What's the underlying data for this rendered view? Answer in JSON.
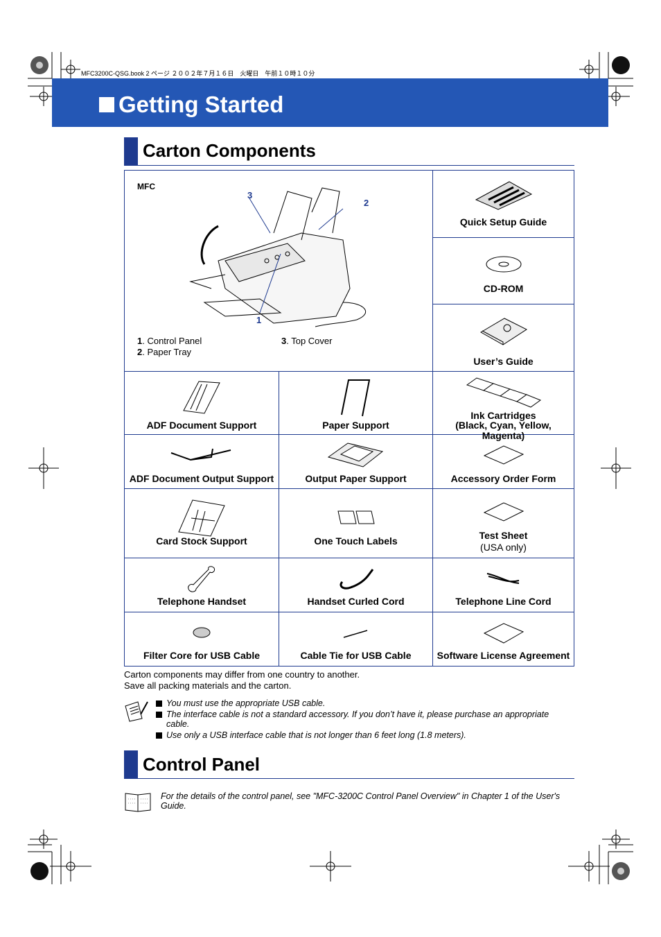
{
  "header": {
    "book_line": "MFC3200C-QSG.book 2 ページ ２００２年７月１６日　火曜日　午前１０時１０分",
    "banner_title": "Getting Started",
    "banner_color": "#2457b5",
    "accent_color": "#1e3a8f"
  },
  "carton": {
    "title": "Carton Components",
    "mfc": {
      "label": "MFC",
      "callouts": [
        "1",
        "2",
        "3"
      ],
      "legend": [
        {
          "num": "1",
          "text": ". Control Panel"
        },
        {
          "num": "2",
          "text": ". Paper Tray"
        },
        {
          "num": "3",
          "text": ". Top Cover"
        }
      ]
    },
    "items": [
      {
        "label": "Quick Setup Guide",
        "icon": "booklet-icon"
      },
      {
        "label": "CD-ROM",
        "icon": "cd-icon"
      },
      {
        "label": "User’s Guide",
        "icon": "book-icon"
      },
      {
        "label": "ADF Document Support",
        "icon": "adf-support-icon"
      },
      {
        "label": "Paper Support",
        "icon": "paper-support-icon"
      },
      {
        "label": "Ink Cartridges",
        "sub": "(Black, Cyan, Yellow, Magenta)",
        "icon": "ink-cartridge-icon"
      },
      {
        "label": "ADF Document Output Support",
        "icon": "wire-icon"
      },
      {
        "label": "Output Paper Support",
        "icon": "tray-icon"
      },
      {
        "label": "Accessory Order Form",
        "icon": "sheet-icon"
      },
      {
        "label": "Card Stock Support",
        "icon": "card-stock-icon"
      },
      {
        "label": "One Touch Labels",
        "icon": "labels-icon"
      },
      {
        "label": "Test Sheet",
        "sub": "(USA only)",
        "icon": "sheet-icon"
      },
      {
        "label": "Telephone Handset",
        "icon": "handset-icon"
      },
      {
        "label": "Handset Curled Cord",
        "icon": "curled-cord-icon"
      },
      {
        "label": "Telephone Line Cord",
        "icon": "line-cord-icon"
      },
      {
        "label": "Filter Core for USB Cable",
        "icon": "filter-core-icon"
      },
      {
        "label": "Cable Tie for USB Cable",
        "icon": "cable-tie-icon"
      },
      {
        "label": "Software License Agreement",
        "icon": "sheet-icon"
      }
    ],
    "footnote": [
      "Carton components may differ from one country to another.",
      "Save all packing materials and the carton."
    ],
    "notes": [
      "You must use the appropriate USB cable.",
      "The interface cable is not a standard accessory. If you don’t have it, please purchase an appropriate cable.",
      "Use only a USB interface cable that is not longer than 6 feet long (1.8 meters)."
    ]
  },
  "control_panel": {
    "title": "Control Panel",
    "note": "For the details of the control panel, see \"MFC-3200C Control Panel Overview\" in Chapter 1 of the User's Guide."
  }
}
